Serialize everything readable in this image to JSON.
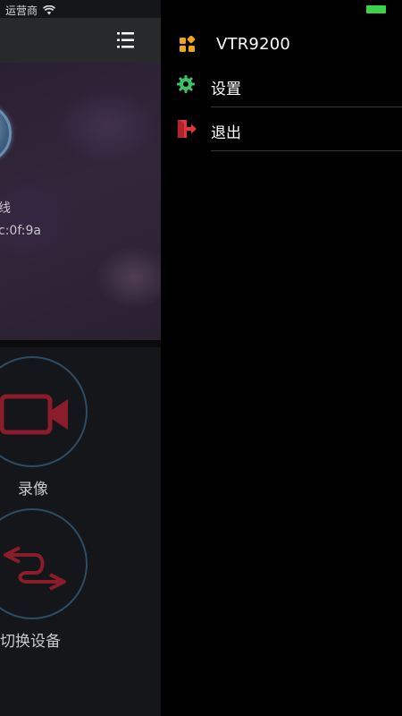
{
  "status_bar": {
    "carrier": "运营商",
    "wifi_icon": "wifi-icon",
    "battery_icon": "battery-icon",
    "battery_color": "#3bd14a"
  },
  "background_page": {
    "menu_icon": "list-menu-icon",
    "device_status_text": "线",
    "device_mac_text": "c:0f:9a",
    "actions": [
      {
        "label": "录像",
        "icon": "video-camera-icon",
        "color": "#8a1c2c"
      },
      {
        "label": "切换设备",
        "icon": "switch-arrows-icon",
        "color": "#8a1c2c"
      }
    ]
  },
  "drawer": {
    "app_icon": "app-grid-icon",
    "app_icon_color": "#f0a41e",
    "title": "VTR9200",
    "items": [
      {
        "label": "设置",
        "icon": "gear-icon",
        "icon_color": "#3fbf6e"
      },
      {
        "label": "退出",
        "icon": "exit-door-icon",
        "icon_color": "#e0353c"
      }
    ]
  }
}
